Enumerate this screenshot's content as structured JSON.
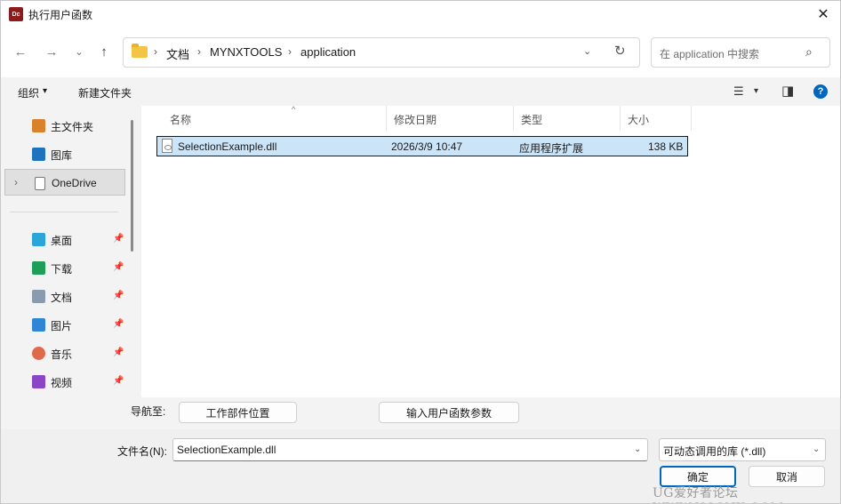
{
  "titlebar": {
    "app_icon_text": "Dc",
    "title": "执行用户函数",
    "close_glyph": "✕"
  },
  "navigation": {
    "back_glyph": "←",
    "forward_glyph": "→",
    "recent_glyph": "⌄",
    "up_glyph": "↑"
  },
  "address": {
    "crumbs": [
      "文档",
      "MYNXTOOLS",
      "application"
    ],
    "sep": "›",
    "dropdown_glyph": "⌄",
    "refresh_glyph": "↻"
  },
  "search": {
    "placeholder": "在 application 中搜索",
    "icon_glyph": "⌕"
  },
  "toolbar": {
    "organize_label": "组织",
    "organize_caret": "▾",
    "new_folder_label": "新建文件夹",
    "view_glyph": "☰",
    "view_caret": "▾",
    "preview_glyph": "◨",
    "help_glyph": "?"
  },
  "sidebar": {
    "items": [
      {
        "label": "主文件夹",
        "icon": "home-icon",
        "color": "#d9822b"
      },
      {
        "label": "图库",
        "icon": "gallery-icon",
        "color": "#1e73be"
      },
      {
        "label": "OneDrive",
        "icon": "onedrive-icon",
        "color": "#ffffff",
        "chevron": "›"
      },
      {
        "label": "桌面",
        "icon": "desktop-icon",
        "color": "#2aa6d8",
        "pin": "📌"
      },
      {
        "label": "下载",
        "icon": "download-icon",
        "color": "#1f9e5a",
        "pin": "📌"
      },
      {
        "label": "文档",
        "icon": "documents-icon",
        "color": "#8a9bb0",
        "pin": "📌"
      },
      {
        "label": "图片",
        "icon": "pictures-icon",
        "color": "#2f86d6",
        "pin": "📌"
      },
      {
        "label": "音乐",
        "icon": "music-icon",
        "color": "#e0684b",
        "pin": "📌"
      },
      {
        "label": "视频",
        "icon": "videos-icon",
        "color": "#8b45c7",
        "pin": "📌"
      }
    ]
  },
  "columns": {
    "name": "名称",
    "modified": "修改日期",
    "type": "类型",
    "size": "大小",
    "sort_glyph": "^"
  },
  "files": [
    {
      "name": "SelectionExample.dll",
      "modified": "2026/3/9 10:47",
      "type": "应用程序扩展",
      "size": "138 KB"
    }
  ],
  "navrow": {
    "label": "导航至:",
    "work_part_button": "工作部件位置",
    "input_params_button": "输入用户函数参数"
  },
  "bottom": {
    "filename_label": "文件名(N):",
    "filename_value": "SelectionExample.dll",
    "filter_value": "可动态调用的库 (*.dll)",
    "dropdown_glyph": "⌄",
    "ok_button": "确定",
    "cancel_button": "取消",
    "watermark": "UG爱好者论坛 WWW.UGSNX.COM"
  },
  "colors": {
    "selection_bg": "#cce4f7",
    "accent": "#0067c0"
  }
}
